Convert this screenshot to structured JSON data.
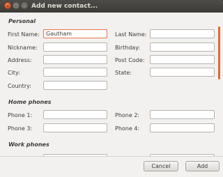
{
  "window": {
    "title": "Add new contact...",
    "controls": {
      "close": "×",
      "minimize": "–",
      "maximize": "□"
    }
  },
  "sections": {
    "personal": "Personal",
    "home_phones": "Home phones",
    "work_phones": "Work phones"
  },
  "personal": {
    "first_name": {
      "label": "First Name:",
      "value": "Gautham"
    },
    "last_name": {
      "label": "Last Name:",
      "value": ""
    },
    "nickname": {
      "label": "Nickname:",
      "value": ""
    },
    "birthday": {
      "label": "Birthday:",
      "value": ""
    },
    "address": {
      "label": "Address:",
      "value": ""
    },
    "post_code": {
      "label": "Post Code:",
      "value": ""
    },
    "city": {
      "label": "City:",
      "value": ""
    },
    "state": {
      "label": "State:",
      "value": ""
    },
    "country": {
      "label": "Country:",
      "value": ""
    }
  },
  "home_phones": {
    "phone1": {
      "label": "Phone 1:",
      "value": ""
    },
    "phone2": {
      "label": "Phone 2:",
      "value": ""
    },
    "phone3": {
      "label": "Phone 3:",
      "value": ""
    },
    "phone4": {
      "label": "Phone 4:",
      "value": ""
    }
  },
  "buttons": {
    "cancel": "Cancel",
    "add": "Add"
  },
  "colors": {
    "accent": "#e7724a",
    "titlebar": "#3c3b37",
    "background": "#f2f1f0"
  }
}
